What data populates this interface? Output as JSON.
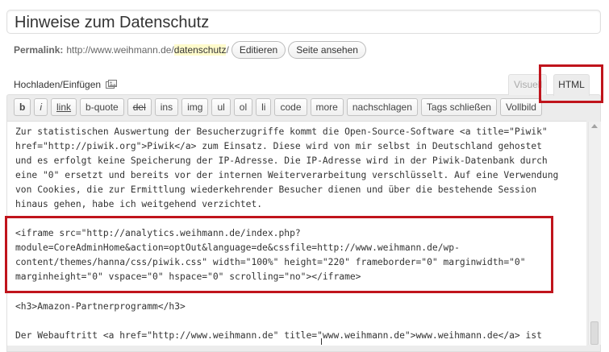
{
  "post": {
    "title": "Hinweise zum Datenschutz"
  },
  "permalink": {
    "label": "Permalink:",
    "base_url": "http://www.weihmann.de/",
    "slug": "datenschutz",
    "trailing": "/",
    "edit_label": "Editieren",
    "view_label": "Seite ansehen"
  },
  "upload": {
    "label": "Hochladen/Einfügen",
    "icon": "media-icon"
  },
  "tabs": {
    "visual": "Visuell",
    "html": "HTML"
  },
  "toolbar": {
    "buttons": [
      "b",
      "i",
      "link",
      "b-quote",
      "del",
      "ins",
      "img",
      "ul",
      "ol",
      "li",
      "code",
      "more",
      "nachschlagen",
      "Tags schließen",
      "Vollbild"
    ]
  },
  "editor": {
    "lines": [
      "Zur statistischen Auswertung der Besucherzugriffe kommt die Open-Source-Software <a title=\"Piwik\"",
      "href=\"http://piwik.org\">Piwik</a> zum Einsatz. Diese wird von mir selbst in Deutschland gehostet",
      "und es erfolgt keine Speicherung der IP-Adresse. Die IP-Adresse wird in der Piwik-Datenbank durch",
      "eine \"0\" ersetzt und bereits vor der internen Weiterverarbeitung verschlüsselt. Auf eine Verwendung",
      "von Cookies, die zur Ermittlung wiederkehrender Besucher dienen und über die bestehende Session",
      "hinaus gehen, habe ich weitgehend verzichtet.",
      "",
      "<iframe src=\"http://analytics.weihmann.de/index.php?",
      "module=CoreAdminHome&action=optOut&language=de&cssfile=http://www.weihmann.de/wp-",
      "content/themes/hanna/css/piwik.css\" width=\"100%\" height=\"220\" frameborder=\"0\" marginwidth=\"0\"",
      "marginheight=\"0\" vspace=\"0\" hspace=\"0\" scrolling=\"no\"></iframe>",
      "",
      "<h3>Amazon-Partnerprogramm</h3>",
      "",
      "Der Webauftritt <a href=\"http://www.weihmann.de\" title=\"www.weihmann.de\">www.weihmann.de</a> ist"
    ]
  },
  "colors": {
    "highlight": "#c0141c",
    "slug_background": "#fffbcc"
  }
}
